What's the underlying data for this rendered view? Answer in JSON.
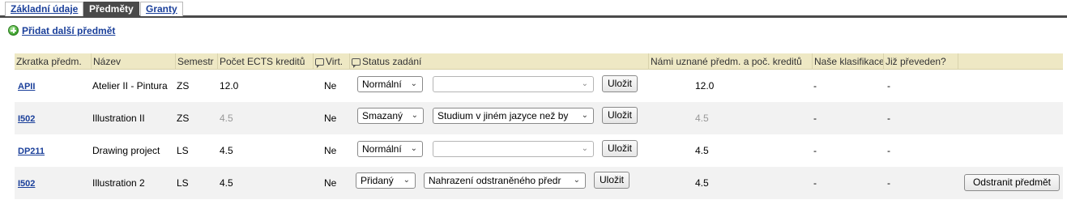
{
  "tabs": [
    {
      "label": "Základní údaje",
      "active": false
    },
    {
      "label": "Předměty",
      "active": true
    },
    {
      "label": "Granty",
      "active": false
    }
  ],
  "add_link": "Přidat další předmět",
  "headers": {
    "code": "Zkratka předm.",
    "name": "Název",
    "semester": "Semestr",
    "ects": "Počet ECTS kreditů",
    "virt": "Virt.",
    "status": "Status zadání",
    "recognized": "Námi uznané předm. a poč. kreditů",
    "grade": "Naše klasifikace",
    "transferred": "Již převeden?"
  },
  "rows": [
    {
      "code": "APII",
      "name": "Atelier II - Pintura",
      "semester": "ZS",
      "ects": "12.0",
      "ects_grey": false,
      "virt": "Ne",
      "status": "Normální",
      "reason": "",
      "save": "Uložit",
      "recognized": "12.0",
      "recognized_grey": false,
      "grade": "-",
      "transferred": "-",
      "remove": ""
    },
    {
      "code": "I502",
      "name": "Illustration II",
      "semester": "ZS",
      "ects": "4.5",
      "ects_grey": true,
      "virt": "Ne",
      "status": "Smazaný",
      "reason": "Studium v jiném jazyce než by",
      "save": "Uložit",
      "recognized": "4.5",
      "recognized_grey": true,
      "grade": "-",
      "transferred": "-",
      "remove": ""
    },
    {
      "code": "DP211",
      "name": "Drawing project",
      "semester": "LS",
      "ects": "4.5",
      "ects_grey": false,
      "virt": "Ne",
      "status": "Normální",
      "reason": "",
      "save": "Uložit",
      "recognized": "4.5",
      "recognized_grey": false,
      "grade": "-",
      "transferred": "-",
      "remove": ""
    },
    {
      "code": "I502",
      "name": "Illustration 2",
      "semester": "LS",
      "ects": "4.5",
      "ects_grey": false,
      "virt": "Ne",
      "status": "Přidaný",
      "reason": "Nahrazení odstraněného předr",
      "save": "Uložit",
      "recognized": "4.5",
      "recognized_grey": false,
      "grade": "-",
      "transferred": "-",
      "remove": "Odstranit předmět"
    }
  ],
  "icons": {
    "add": "add-circle-icon",
    "comment": "comment-icon",
    "dropdown": "chevron-down-icon"
  },
  "colors": {
    "link": "#1a3f9a",
    "header_bg": "#eee8c4",
    "tab_active": "#4a4a4a",
    "add_icon": "#3aa02a"
  }
}
